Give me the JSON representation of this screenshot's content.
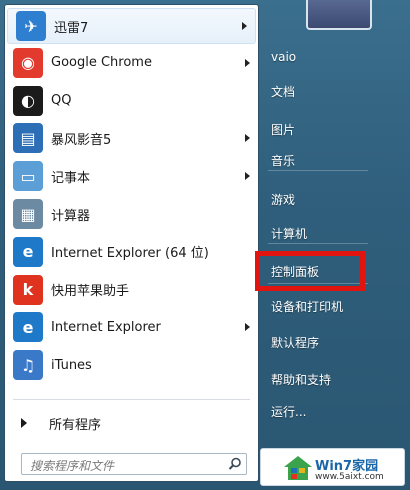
{
  "programs": [
    {
      "label": "迅雷7",
      "icon": "xunlei-bird-icon",
      "color": "#2f7fd0",
      "glyph": "✈",
      "arrow": true
    },
    {
      "label": "Google Chrome",
      "icon": "chrome-icon",
      "color": "#e23b2e",
      "glyph": "◉",
      "arrow": true
    },
    {
      "label": "QQ",
      "icon": "qq-penguin-icon",
      "color": "#1b1b1b",
      "glyph": "◐",
      "arrow": false
    },
    {
      "label": "暴风影音5",
      "icon": "baofeng-film-icon",
      "color": "#2d6fb6",
      "glyph": "▤",
      "arrow": true
    },
    {
      "label": "记事本",
      "icon": "notepad-icon",
      "color": "#5c9fd6",
      "glyph": "▭",
      "arrow": true
    },
    {
      "label": "计算器",
      "icon": "calculator-icon",
      "color": "#6d8aa3",
      "glyph": "▦",
      "arrow": false
    },
    {
      "label": "Internet Explorer (64 位)",
      "icon": "internet-explorer-icon",
      "color": "#1e7ac8",
      "glyph": "e",
      "arrow": false
    },
    {
      "label": "快用苹果助手",
      "icon": "kuaiyong-icon",
      "color": "#e0331f",
      "glyph": "k",
      "arrow": false
    },
    {
      "label": "Internet Explorer",
      "icon": "internet-explorer-icon",
      "color": "#1e7ac8",
      "glyph": "e",
      "arrow": true
    },
    {
      "label": "iTunes",
      "icon": "itunes-icon",
      "color": "#3a78c8",
      "glyph": "♫",
      "arrow": false
    }
  ],
  "all_programs": "所有程序",
  "search": {
    "placeholder": "搜索程序和文件"
  },
  "right_items": [
    {
      "label": "vaio",
      "key": "user"
    },
    {
      "label": "文档",
      "key": "documents"
    },
    {
      "label": "图片",
      "key": "pictures"
    },
    {
      "label": "音乐",
      "key": "music"
    },
    {
      "label": "游戏",
      "key": "games"
    },
    {
      "label": "计算机",
      "key": "computer"
    },
    {
      "label": "控制面板",
      "key": "control-panel"
    },
    {
      "label": "设备和打印机",
      "key": "devices-printers"
    },
    {
      "label": "默认程序",
      "key": "default-programs"
    },
    {
      "label": "帮助和支持",
      "key": "help-support"
    },
    {
      "label": "运行...",
      "key": "run"
    }
  ],
  "watermark": {
    "title": "Win7家园",
    "url": "www.5aixt.com"
  },
  "colors": {
    "highlight": "#e2140f",
    "menu_blue": "#2f5f7c"
  }
}
